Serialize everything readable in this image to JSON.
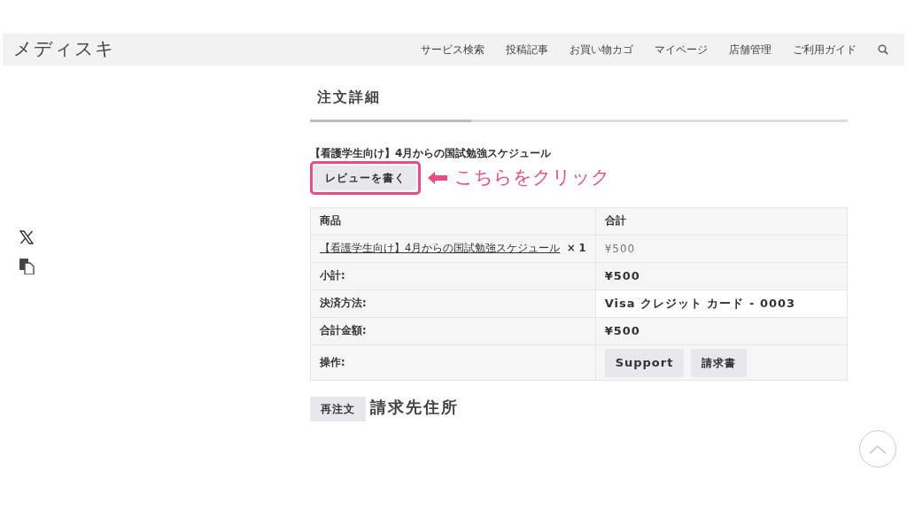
{
  "header": {
    "logo": "メディスキ",
    "nav": [
      {
        "label": "サービス検索"
      },
      {
        "label": "投稿記事"
      },
      {
        "label": "お買い物カゴ"
      },
      {
        "label": "マイページ"
      },
      {
        "label": "店舗管理"
      },
      {
        "label": "ご利用ガイド"
      }
    ]
  },
  "page_title": "注文詳細",
  "product_title": "【看護学生向け】4月からの国試勉強スケジュール",
  "review_button": "レビューを書く",
  "annotation": {
    "text": "こちらをクリック"
  },
  "table": {
    "columns": [
      "商品",
      "合計"
    ],
    "rows": [
      {
        "kind": "item",
        "link": "【看護学生向け】4月からの国試勉強スケジュール",
        "quantity": "× 1",
        "value": "¥500"
      },
      {
        "kind": "total",
        "label": "小計:",
        "value": "¥500"
      },
      {
        "kind": "total",
        "label": "決済方法:",
        "value": "Visa クレジット カード - 0003"
      },
      {
        "kind": "total",
        "label": "合計金額:",
        "value": "¥500"
      },
      {
        "kind": "actions",
        "label": "操作:",
        "buttons": [
          "Support",
          "請求書"
        ]
      }
    ]
  },
  "reorder_button": "再注文",
  "next_section_title": "請求先住所"
}
